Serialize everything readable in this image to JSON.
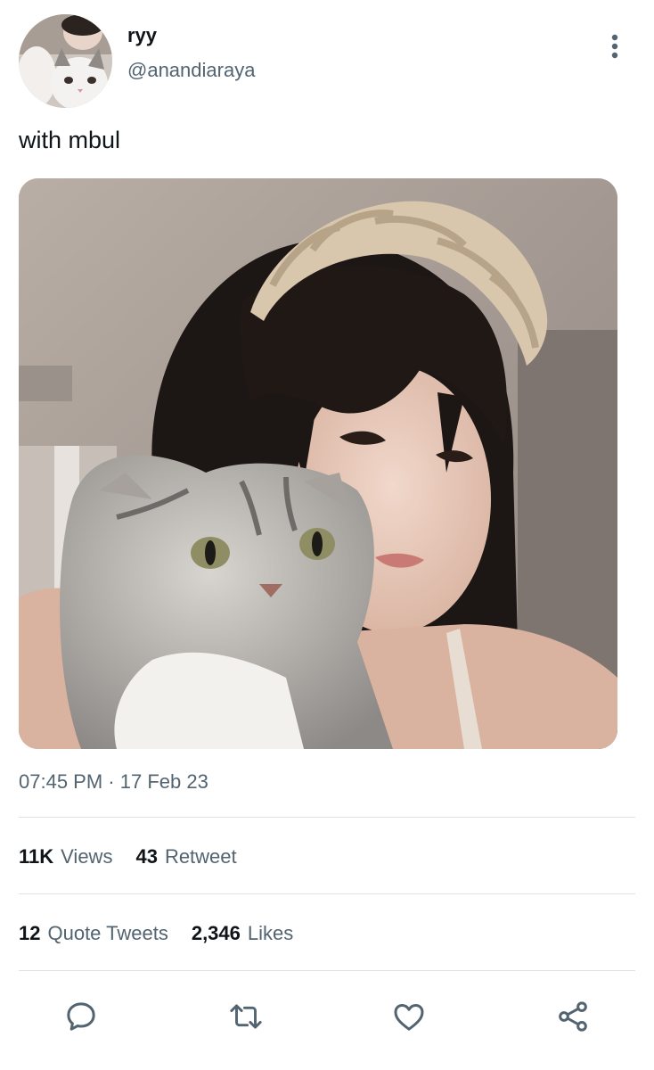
{
  "author": {
    "display_name": "ryy",
    "handle": "@anandiaraya",
    "avatar_icon": "avatar-cat-icon"
  },
  "tweet": {
    "text": "with mbul",
    "media_description_icon": "photo-image",
    "time": "07:45 PM",
    "separator": "·",
    "date": "17 Feb 23"
  },
  "stats": {
    "views_count": "11K",
    "views_label": "Views",
    "retweet_count": "43",
    "retweet_label": "Retweet",
    "quote_count": "12",
    "quote_label": "Quote Tweets",
    "likes_count": "2,346",
    "likes_label": "Likes"
  },
  "actions": {
    "reply_icon": "reply-icon",
    "retweet_icon": "retweet-icon",
    "like_icon": "heart-icon",
    "share_icon": "share-icon"
  },
  "colors": {
    "text_primary": "#0f1419",
    "text_secondary": "#536471",
    "divider": "#dfe3e6",
    "icon": "#536471"
  }
}
